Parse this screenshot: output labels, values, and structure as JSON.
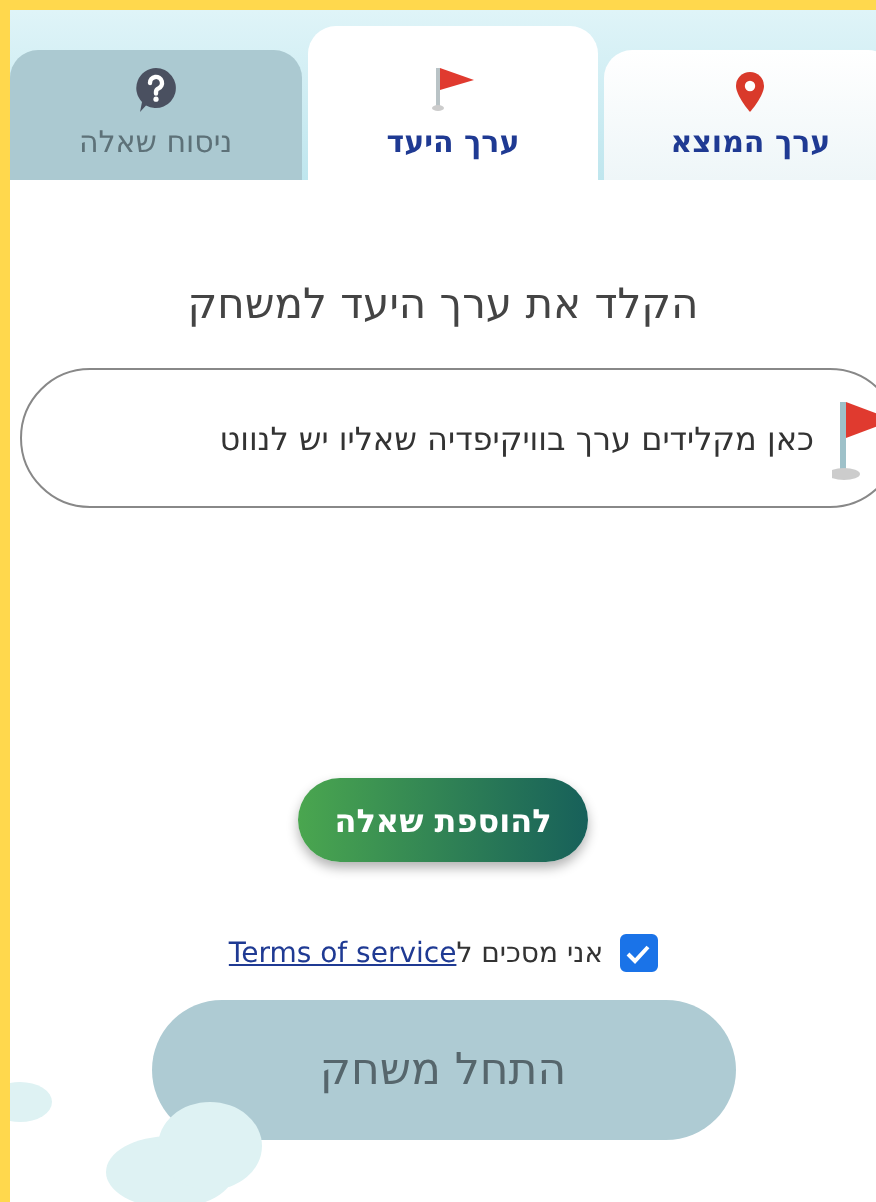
{
  "tabs": [
    {
      "label": "ערך המוצא",
      "kind": "origin",
      "selected": false,
      "disabled": false
    },
    {
      "label": "ערך היעד",
      "kind": "target",
      "selected": true,
      "disabled": false
    },
    {
      "label": "ניסוח שאלה",
      "kind": "question",
      "selected": false,
      "disabled": true
    }
  ],
  "heading": "הקלד את ערך היעד למשחק",
  "target_field": {
    "placeholder": "כאן מקלידים ערך בוויקיפדיה שאליו יש לנווט"
  },
  "add_question_button": "להוספת שאלה",
  "agreement": {
    "text": "אני מסכים ל",
    "link": "Terms of service",
    "checked": true
  },
  "start_button": {
    "label": "התחל משחק",
    "disabled": true
  }
}
